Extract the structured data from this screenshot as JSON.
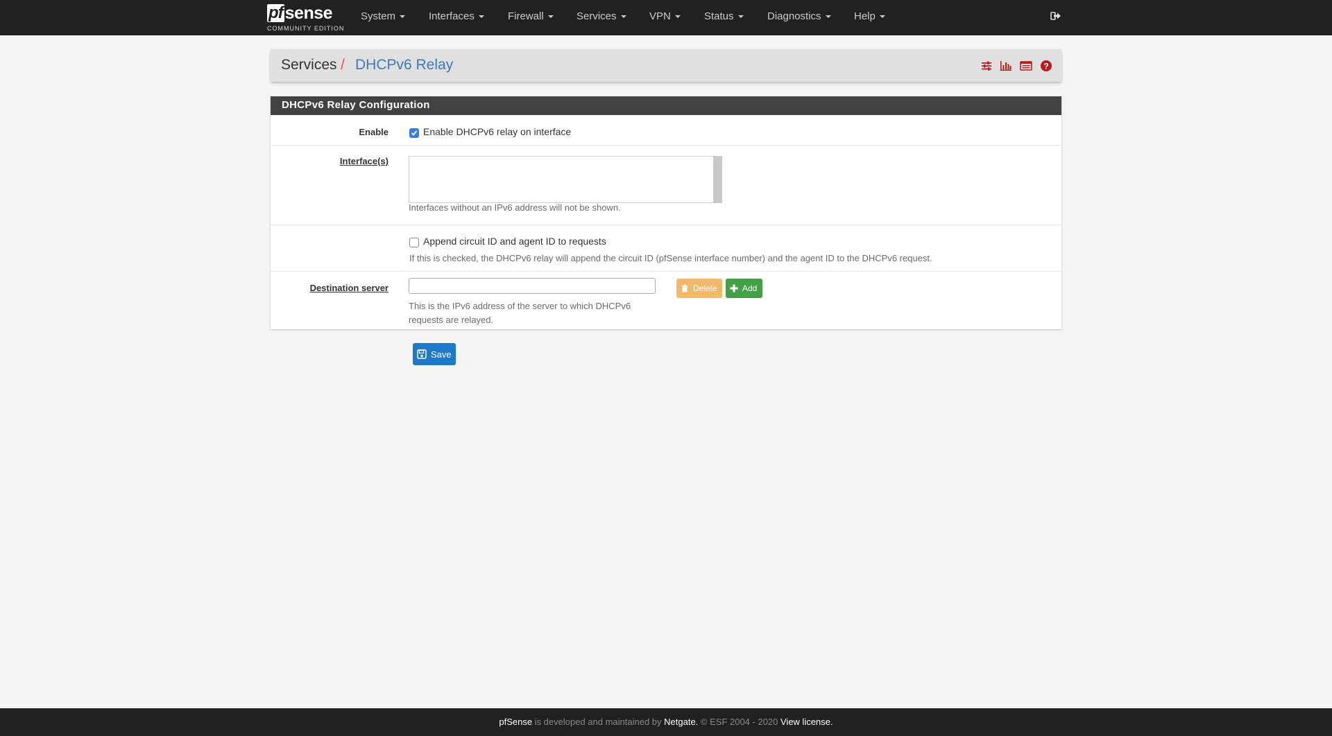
{
  "brand": {
    "logo_pf": "pf",
    "logo_sense": "sense",
    "edition": "COMMUNITY EDITION"
  },
  "nav": {
    "items": [
      {
        "label": "System"
      },
      {
        "label": "Interfaces"
      },
      {
        "label": "Firewall"
      },
      {
        "label": "Services"
      },
      {
        "label": "VPN"
      },
      {
        "label": "Status"
      },
      {
        "label": "Diagnostics"
      },
      {
        "label": "Help"
      }
    ],
    "logout_icon": "sign-out-icon"
  },
  "breadcrumb": {
    "root": "Services",
    "separator": "/",
    "current": "DHCPv6 Relay"
  },
  "header_icons": [
    "sliders-icon",
    "bar-chart-icon",
    "log-list-icon",
    "help-circle-icon"
  ],
  "panel": {
    "title": "DHCPv6 Relay Configuration",
    "enable": {
      "label": "Enable",
      "checkbox_label": "Enable DHCPv6 relay on interface",
      "checked": true
    },
    "interfaces": {
      "label": "Interface(s)",
      "help": "Interfaces without an IPv6 address will not be shown."
    },
    "append": {
      "checkbox_label": "Append circuit ID and agent ID to requests",
      "checked": false,
      "help": "If this is checked, the DHCPv6 relay will append the circuit ID (pfSense interface number) and the agent ID to the DHCPv6 request."
    },
    "destination": {
      "label": "Destination server",
      "value": "",
      "help_line1": "This is the IPv6 address of the server to which DHCPv6",
      "help_line2": "requests are relayed.",
      "delete_label": "Delete",
      "add_label": "Add"
    }
  },
  "save_label": "Save",
  "footer": {
    "brand": "pfSense",
    "text1": " is developed and maintained by ",
    "company": "Netgate.",
    "text2": " © ESF 2004 - 2020 ",
    "license": "View license."
  },
  "colors": {
    "navbar": "#212121",
    "accent_red": "#d9534f",
    "link_blue": "#3c7ab8",
    "save_blue": "#1e7ac9",
    "add_green": "#43a047",
    "delete_orange": "#f0ad4e"
  }
}
